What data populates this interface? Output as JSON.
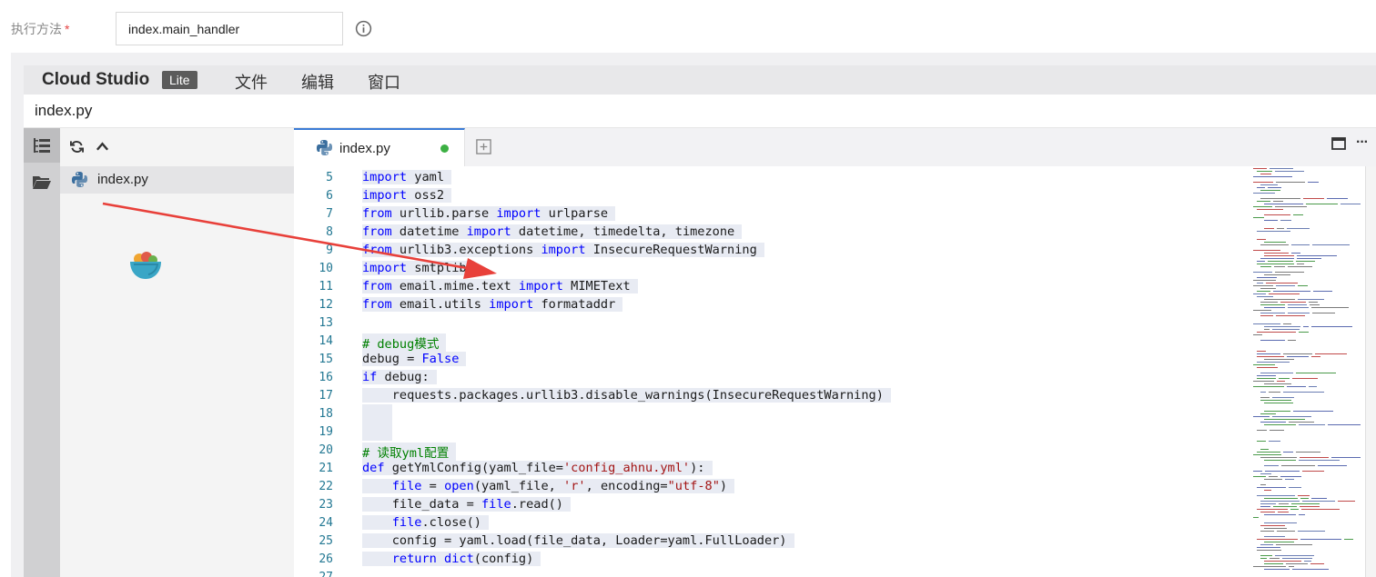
{
  "form": {
    "label": "执行方法",
    "required_mark": "*",
    "handler_value": "index.main_handler"
  },
  "studio": {
    "brand": "Cloud Studio",
    "badge": "Lite",
    "menu": [
      "文件",
      "编辑",
      "窗口"
    ],
    "path": "index.py"
  },
  "explorer": {
    "files": [
      "index.py"
    ]
  },
  "editor": {
    "tab_label": "index.py",
    "tab_modified": true,
    "lines": [
      {
        "n": "5",
        "code": "import yaml"
      },
      {
        "n": "6",
        "code": "import oss2"
      },
      {
        "n": "7",
        "code": "from urllib.parse import urlparse"
      },
      {
        "n": "8",
        "code": "from datetime import datetime, timedelta, timezone"
      },
      {
        "n": "9",
        "code": "from urllib3.exceptions import InsecureRequestWarning"
      },
      {
        "n": "10",
        "code": "import smtplib"
      },
      {
        "n": "11",
        "code": "from email.mime.text import MIMEText"
      },
      {
        "n": "12",
        "code": "from email.utils import formataddr"
      },
      {
        "n": "13",
        "code": ""
      },
      {
        "n": "14",
        "code": "# debug模式"
      },
      {
        "n": "15",
        "code": "debug = False"
      },
      {
        "n": "16",
        "code": "if debug:"
      },
      {
        "n": "17",
        "code": "    requests.packages.urllib3.disable_warnings(InsecureRequestWarning)"
      },
      {
        "n": "18",
        "code": ""
      },
      {
        "n": "19",
        "code": ""
      },
      {
        "n": "20",
        "code": "# 读取yml配置"
      },
      {
        "n": "21",
        "code": "def getYmlConfig(yaml_file='config_ahnu.yml'):"
      },
      {
        "n": "22",
        "code": "    file = open(yaml_file, 'r', encoding=\"utf-8\")"
      },
      {
        "n": "23",
        "code": "    file_data = file.read()"
      },
      {
        "n": "24",
        "code": "    file.close()"
      },
      {
        "n": "25",
        "code": "    config = yaml.load(file_data, Loader=yaml.FullLoader)"
      },
      {
        "n": "26",
        "code": "    return dict(config)"
      },
      {
        "n": "27",
        "code": ""
      }
    ]
  },
  "colors": {
    "keyword": "#0000ff",
    "string": "#a31515",
    "comment": "#008000",
    "line_number": "#237893",
    "arrow": "#e8403a",
    "tab_accent": "#3a7bd5",
    "modified_dot": "#3cb043"
  },
  "icons": {
    "info": "info-circle-icon",
    "tree": "file-tree-icon",
    "folder": "folder-icon",
    "refresh": "refresh-icon",
    "collapse": "chevron-up-icon",
    "python": "python-icon",
    "add_tab": "plus-square-icon",
    "maximize": "maximize-icon",
    "more": "more-icon"
  }
}
